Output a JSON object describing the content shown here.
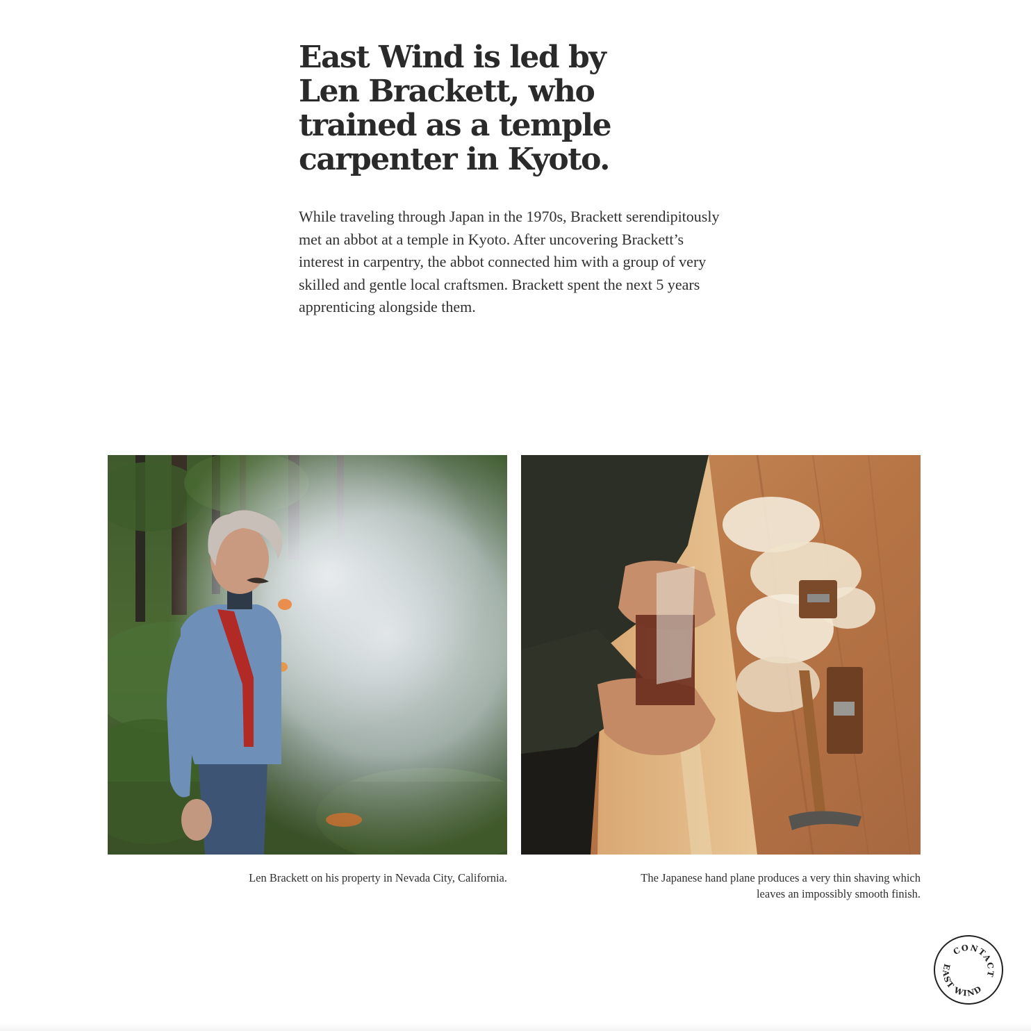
{
  "intro": {
    "headline": "East Wind is led by Len Brackett, who trained as a temple carpenter in Kyoto.",
    "body": "While traveling through Japan in the 1970s, Brackett serendipitously met an abbot at a temple in Kyoto. After uncovering Brackett’s interest in carpentry, the abbot connected him with a group of very skilled and gentle local craftsmen. Brackett spent the next 5 years apprenticing alongside them."
  },
  "figures": [
    {
      "caption": "Len Brackett on his property in Nevada City, California."
    },
    {
      "caption": "The Japanese hand plane produces a very thin shaving which leaves an impossibly smooth finish."
    }
  ],
  "contact_badge": {
    "top_text": "CONTACT",
    "bottom_text": "EAST WIND"
  }
}
